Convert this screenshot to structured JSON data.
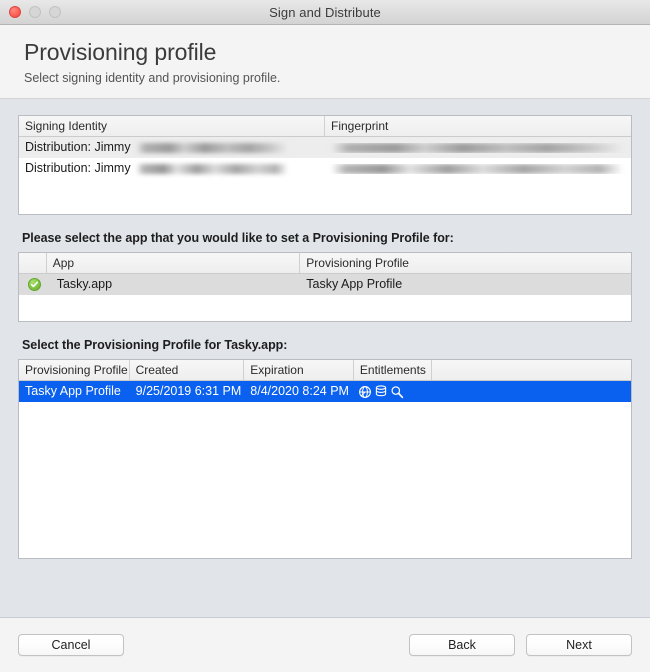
{
  "window": {
    "title": "Sign and Distribute",
    "traffic_lights": [
      "close",
      "minimize",
      "maximize"
    ]
  },
  "header": {
    "title": "Provisioning profile",
    "subtitle": "Select signing identity and provisioning profile."
  },
  "signing_identity_table": {
    "columns": [
      "Signing Identity",
      "Fingerprint"
    ],
    "rows": [
      {
        "identity": "Distribution: Jimmy",
        "identity_redacted": true,
        "fingerprint": "",
        "fingerprint_redacted": true
      },
      {
        "identity": "Distribution: Jimmy",
        "identity_redacted": true,
        "fingerprint": "",
        "fingerprint_redacted": true
      }
    ]
  },
  "app_section": {
    "label": "Please select the app that you would like to set a Provisioning Profile for:",
    "columns": [
      "",
      "App",
      "Provisioning Profile"
    ],
    "rows": [
      {
        "status_icon": "check-circle-icon",
        "app": "Tasky.app",
        "profile": "Tasky App Profile",
        "selected": true
      }
    ]
  },
  "profile_section": {
    "label": "Select the Provisioning Profile for Tasky.app:",
    "columns": [
      "Provisioning Profile",
      "Created",
      "Expiration",
      "Entitlements",
      ""
    ],
    "rows": [
      {
        "profile": "Tasky App Profile",
        "created": "9/25/2019 6:31 PM",
        "expiration": "8/4/2020 8:24 PM",
        "entitlement_icons": [
          "globe-network-icon",
          "database-icon",
          "magnifier-icon"
        ],
        "selected": true
      }
    ]
  },
  "footer": {
    "cancel_label": "Cancel",
    "back_label": "Back",
    "next_label": "Next"
  },
  "colors": {
    "selection_blue": "#0a60ef",
    "check_green": "#7dc242",
    "body_background": "#e1e5ea",
    "panel_background": "#f4f4f4"
  }
}
